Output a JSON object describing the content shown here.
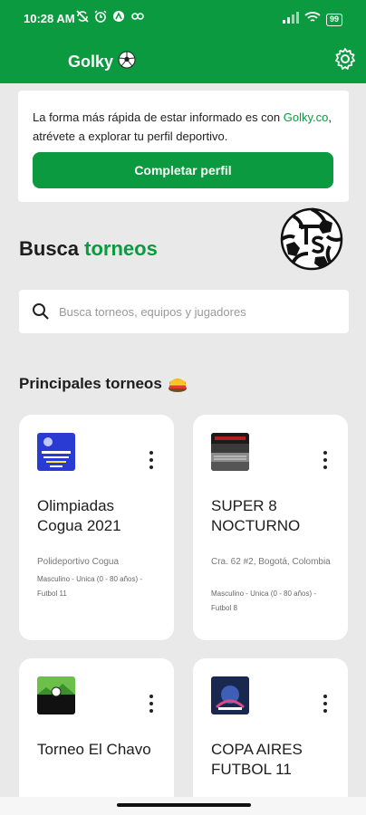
{
  "status_bar": {
    "time": "10:28 AM",
    "battery": "99"
  },
  "app_bar": {
    "title": "Golky"
  },
  "profile_prompt": {
    "text_before": "La forma más rápida de estar informado es con ",
    "link": "Golky.co",
    "text_after": ", atrévete a explorar tu perfil deportivo.",
    "button": "Completar perfil"
  },
  "search_section": {
    "heading_plain": "Busca ",
    "heading_accent": "torneos",
    "placeholder": "Busca torneos, equipos y jugadores"
  },
  "tournaments": {
    "heading": "Principales torneos",
    "items": [
      {
        "name": "Olimpiadas Cogua 2021",
        "location": "Polideportivo Cogua",
        "category": "Masculino - Unica (0 - 80 años) - Futbol 11"
      },
      {
        "name": "SUPER 8 NOCTURNO",
        "location": "Cra. 62 #2, Bogotá, Colombia",
        "category": "Masculino - Unica (0 - 80 años) - Futbol 8"
      },
      {
        "name": "Torneo El Chavo",
        "location": "",
        "category": ""
      },
      {
        "name": "COPA AIRES FUTBOL 11",
        "location": "",
        "category": ""
      }
    ]
  },
  "colors": {
    "brand_green": "#0b9a3f",
    "background": "#e9e9e9"
  }
}
